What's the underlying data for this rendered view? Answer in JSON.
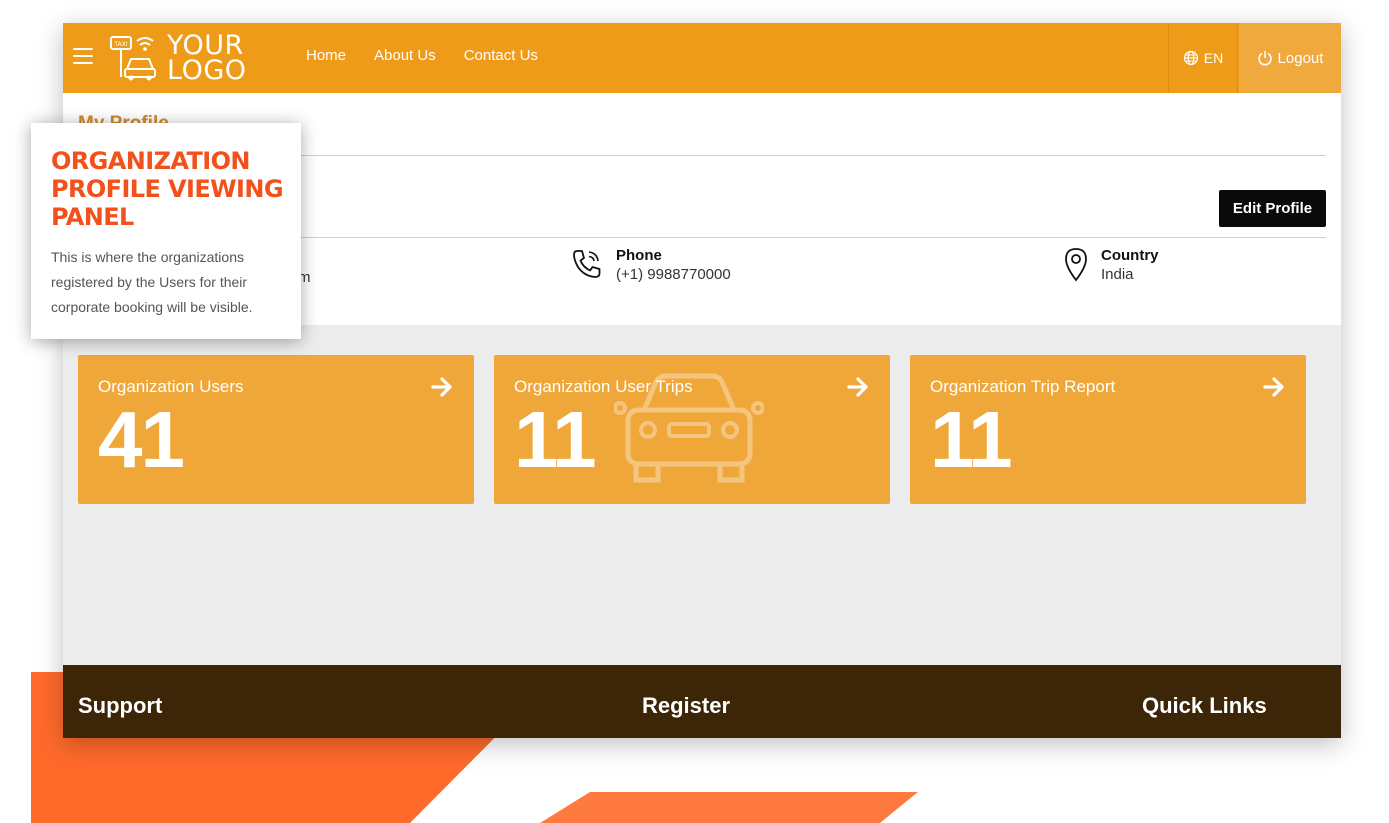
{
  "decor": {
    "accent_color": "#ff6a2b",
    "brand_color": "#ef9b1a"
  },
  "header": {
    "logo_top": "YOUR",
    "logo_bottom": "LOGO",
    "logo_badge": "TAXI",
    "nav": [
      "Home",
      "About Us",
      "Contact Us"
    ],
    "language": "EN",
    "logout_label": "Logout"
  },
  "profile": {
    "title": "My Profile",
    "edit_label": "Edit Profile",
    "email_tail": "m",
    "phone": {
      "label": "Phone",
      "value": "(+1) 9988770000"
    },
    "country": {
      "label": "Country",
      "value": "India"
    }
  },
  "cards": [
    {
      "title": "Organization Users",
      "count": "41"
    },
    {
      "title": "Organization User Trips",
      "count": "11"
    },
    {
      "title": "Organization Trip Report",
      "count": "11"
    }
  ],
  "footer": {
    "support": "Support",
    "register": "Register",
    "quick_links": "Quick Links"
  },
  "callout": {
    "title": "ORGANIZATION PROFILE VIEWING PANEL",
    "body": "This is where the organizations registered by the Users for their corporate booking will be visible."
  }
}
